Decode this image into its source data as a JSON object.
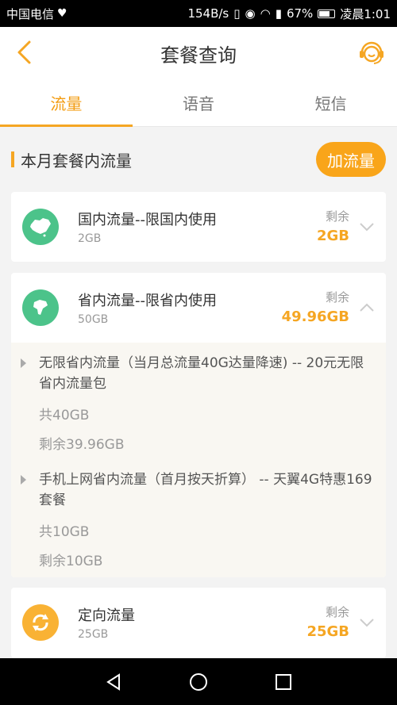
{
  "status_bar": {
    "carrier": "中国电信",
    "speed": "154B/s",
    "battery": "67%",
    "time": "凌晨1:01"
  },
  "header": {
    "title": "套餐查询"
  },
  "tabs": [
    {
      "label": "流量",
      "active": true
    },
    {
      "label": "语音",
      "active": false
    },
    {
      "label": "短信",
      "active": false
    }
  ],
  "section": {
    "title": "本月套餐内流量",
    "add_button": "加流量"
  },
  "cards": [
    {
      "name": "国内流量--限国内使用",
      "total": "2GB",
      "remain_label": "剩余",
      "remain_value": "2GB",
      "icon": "china-map-icon",
      "expanded": false
    },
    {
      "name": "省内流量--限省内使用",
      "total": "50GB",
      "remain_label": "剩余",
      "remain_value": "49.96GB",
      "icon": "province-map-icon",
      "expanded": true,
      "details": [
        {
          "title": "无限省内流量（当月总流量40G达量降速) -- 20元无限省内流量包",
          "total": "共40GB",
          "remain": "剩余39.96GB"
        },
        {
          "title": "手机上网省内流量（首月按天折算） -- 天翼4G特惠169套餐",
          "total": "共10GB",
          "remain": "剩余10GB"
        }
      ]
    },
    {
      "name": "定向流量",
      "total": "25GB",
      "remain_label": "剩余",
      "remain_value": "25GB",
      "icon": "directional-refresh-icon",
      "expanded": false
    }
  ],
  "colors": {
    "accent": "#f5a623",
    "green_icon": "#4cc38a",
    "orange_icon": "#f9b234"
  }
}
